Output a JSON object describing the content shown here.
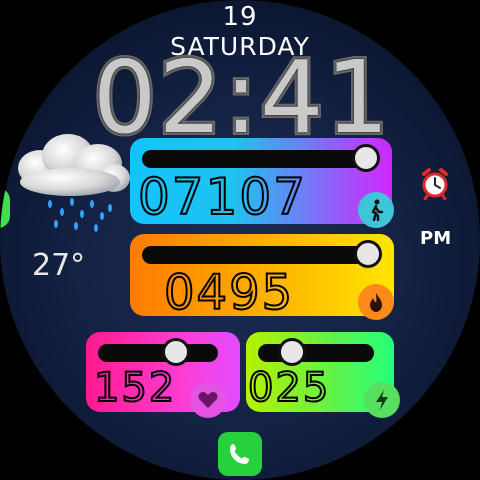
{
  "date": {
    "day": "19",
    "weekday": "SATURDAY"
  },
  "time": {
    "display": "02:41",
    "ampm": "PM"
  },
  "weather": {
    "temperature": "27°",
    "icon": "rain-cloud-icon"
  },
  "alarm": {
    "icon": "alarm-clock-icon"
  },
  "steps": {
    "value": "07107",
    "icon": "walking-icon",
    "progress": 0.9
  },
  "calories": {
    "value": "0495",
    "icon": "flame-icon",
    "progress": 0.9
  },
  "heart_rate": {
    "value": "152",
    "icon": "heart-icon",
    "progress": 0.6
  },
  "battery": {
    "value": "025",
    "icon": "lightning-icon",
    "progress": 0.25
  },
  "shortcut": {
    "icon": "phone-icon"
  },
  "colors": {
    "steps_gradient": [
      "#12c4ff",
      "#d226ff"
    ],
    "calories_gradient": [
      "#ff7b00",
      "#ffe600"
    ],
    "heart_gradient": [
      "#ff1a8e",
      "#e24bff"
    ],
    "battery_gradient": [
      "#b6f200",
      "#25ff7a"
    ],
    "phone": "#26d13b"
  }
}
